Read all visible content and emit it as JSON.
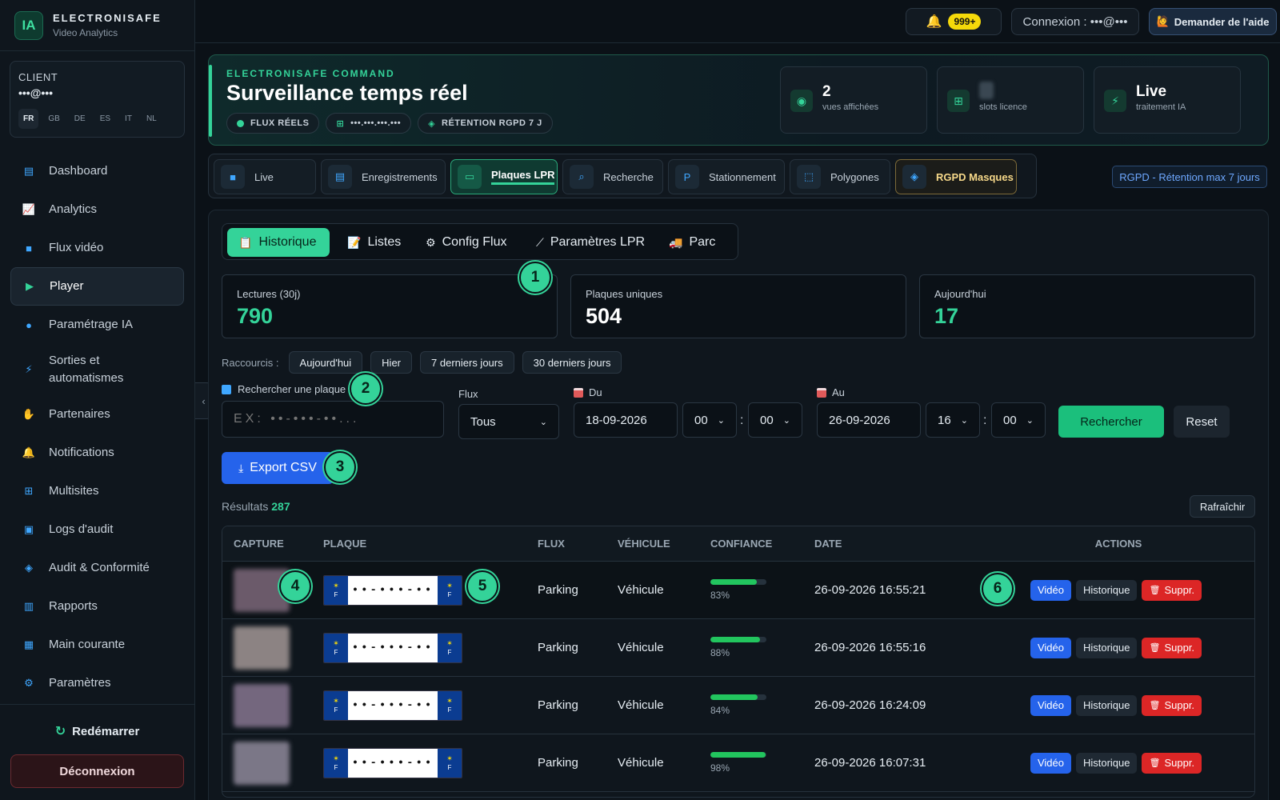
{
  "brand": {
    "logo": "IA",
    "name": "ELECTRONISAFE",
    "sub": "Video Analytics"
  },
  "client": {
    "label": "CLIENT",
    "email": "•••@•••",
    "languages": [
      "FR",
      "GB",
      "DE",
      "ES",
      "IT",
      "NL"
    ],
    "active_language": "FR"
  },
  "sidebar": {
    "items": [
      {
        "label": "Dashboard",
        "icon": "chart-icon"
      },
      {
        "label": "Analytics",
        "icon": "analytics-icon"
      },
      {
        "label": "Flux vidéo",
        "icon": "video-icon"
      },
      {
        "label": "Player",
        "icon": "play-icon",
        "active": true
      },
      {
        "label": "Paramétrage IA",
        "icon": "brain-icon"
      },
      {
        "label": "Sorties et automatismes",
        "icon": "bolt-icon"
      },
      {
        "label": "Partenaires",
        "icon": "handshake-icon"
      },
      {
        "label": "Notifications",
        "icon": "bell-icon"
      },
      {
        "label": "Multisites",
        "icon": "network-icon"
      },
      {
        "label": "Logs d'audit",
        "icon": "clipboard-icon"
      },
      {
        "label": "Audit & Conformité",
        "icon": "shield-icon"
      },
      {
        "label": "Rapports",
        "icon": "document-icon"
      },
      {
        "label": "Main courante",
        "icon": "book-icon"
      },
      {
        "label": "Paramètres",
        "icon": "gear-icon"
      }
    ],
    "restart": "Redémarrer",
    "logout": "Déconnexion"
  },
  "topbar": {
    "notif_badge": "999+",
    "connection": "Connexion : •••@•••",
    "help": "Demander de l'aide"
  },
  "hero": {
    "kicker": "ELECTRONISAFE COMMAND",
    "title": "Surveillance temps réel",
    "chips": [
      "FLUX RÉELS",
      "•••.•••.•••.•••",
      "RÉTENTION RGPD 7 J"
    ],
    "stats": [
      {
        "value": "2",
        "label": "vues affichées"
      },
      {
        "value": "",
        "label": "slots licence"
      },
      {
        "value": "Live",
        "label": "traitement IA"
      }
    ]
  },
  "tabs": [
    {
      "label": "Live"
    },
    {
      "label": "Enregistrements"
    },
    {
      "label": "Plaques LPR",
      "active": true
    },
    {
      "label": "Recherche"
    },
    {
      "label": "Stationnement"
    },
    {
      "label": "Polygones"
    },
    {
      "label": "RGPD Masques"
    }
  ],
  "rgpd_tag": "RGPD - Rétention max 7 jours",
  "subtabs": [
    "Historique",
    "Listes",
    "Config Flux",
    "Paramètres LPR",
    "Parc"
  ],
  "markers": [
    "1",
    "2",
    "3",
    "4",
    "5",
    "6"
  ],
  "kpis": [
    {
      "label": "Lectures (30j)",
      "value": "790",
      "color": "#34d399"
    },
    {
      "label": "Plaques uniques",
      "value": "504",
      "color": "#ffffff"
    },
    {
      "label": "Aujourd'hui",
      "value": "17",
      "color": "#34d399"
    }
  ],
  "shortcuts": {
    "label": "Raccourcis :",
    "items": [
      "Aujourd'hui",
      "Hier",
      "7 derniers jours",
      "30 derniers jours"
    ]
  },
  "filters": {
    "plate_label": "Rechercher une plaque",
    "plate_placeholder": "EX: ••-•••-••...",
    "flux_label": "Flux",
    "flux_value": "Tous",
    "from_label": "Du",
    "from_date": "18-09-2026",
    "from_h": "00",
    "from_m": "00",
    "to_label": "Au",
    "to_date": "26-09-2026",
    "to_h": "16",
    "to_m": "00",
    "search": "Rechercher",
    "reset": "Reset"
  },
  "export": "Export CSV",
  "results": {
    "label": "Résultats",
    "count": "287",
    "refresh": "Rafraîchir"
  },
  "table": {
    "headers": [
      "CAPTURE",
      "PLAQUE",
      "FLUX",
      "VÉHICULE",
      "CONFIANCE",
      "DATE",
      "ACTIONS"
    ],
    "rows": [
      {
        "plate": "••-•••-••",
        "flux": "Parking",
        "vehicle": "Véhicule",
        "confidence": 83,
        "confidence_txt": "83%",
        "date": "26-09-2026 16:55:21"
      },
      {
        "plate": "••-•••-••",
        "flux": "Parking",
        "vehicle": "Véhicule",
        "confidence": 88,
        "confidence_txt": "88%",
        "date": "26-09-2026 16:55:16"
      },
      {
        "plate": "••-•••-••",
        "flux": "Parking",
        "vehicle": "Véhicule",
        "confidence": 84,
        "confidence_txt": "84%",
        "date": "26-09-2026 16:24:09"
      },
      {
        "plate": "••-•••-••",
        "flux": "Parking",
        "vehicle": "Véhicule",
        "confidence": 98,
        "confidence_txt": "98%",
        "date": "26-09-2026 16:07:31"
      }
    ],
    "actions": {
      "video": "Vidéo",
      "history": "Historique",
      "delete": "Suppr."
    },
    "plate_country": "F"
  }
}
